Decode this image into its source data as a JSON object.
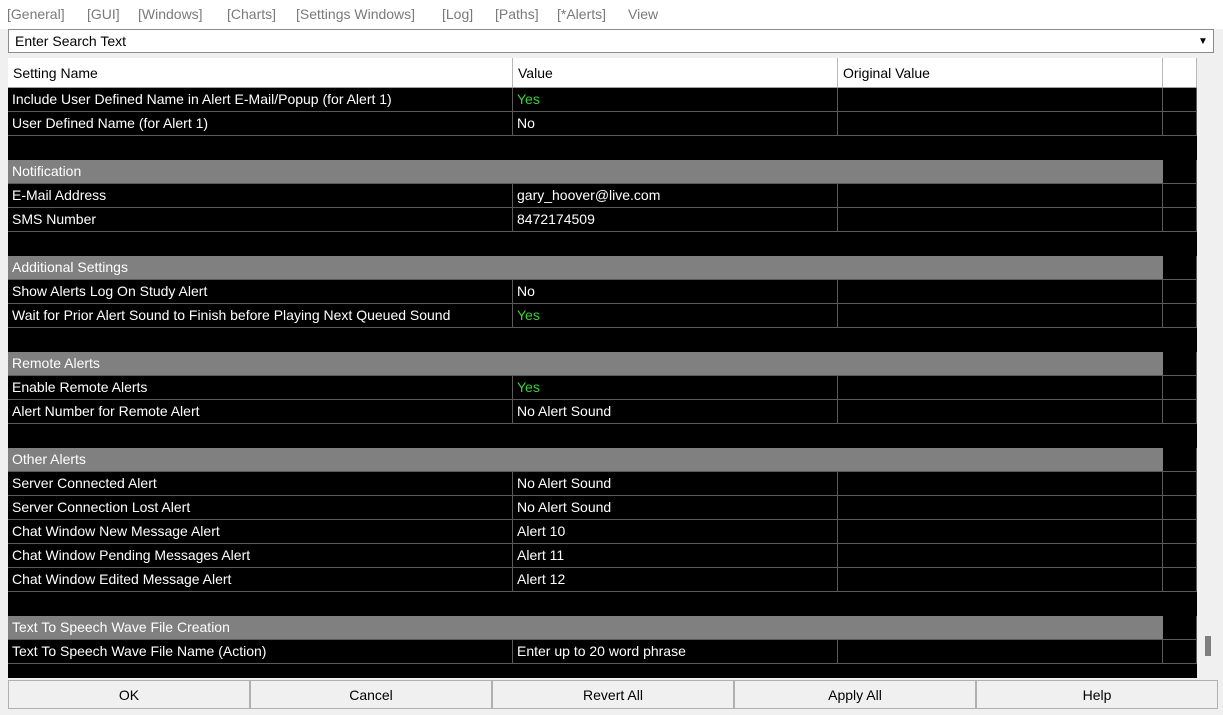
{
  "menu": {
    "tabs": [
      "[General]",
      "[GUI]",
      "[Windows]",
      "[Charts]",
      "[Settings Windows]",
      "[Log]",
      "[Paths]",
      "[*Alerts]",
      "View"
    ]
  },
  "search": {
    "placeholder": "Enter Search Text"
  },
  "grid": {
    "columns": [
      "Setting Name",
      "Value",
      "Original Value"
    ],
    "rows": [
      {
        "type": "item",
        "name": "Include User Defined Name in Alert E-Mail/Popup (for Alert 1)",
        "value": "Yes",
        "original": "",
        "green": true
      },
      {
        "type": "item",
        "name": "User Defined Name (for Alert 1)",
        "value": "No",
        "original": ""
      },
      {
        "type": "blank"
      },
      {
        "type": "section",
        "name": "Notification"
      },
      {
        "type": "item",
        "name": "E-Mail Address",
        "value": "gary_hoover@live.com",
        "original": ""
      },
      {
        "type": "item",
        "name": "SMS Number",
        "value": "8472174509",
        "original": ""
      },
      {
        "type": "blank"
      },
      {
        "type": "section",
        "name": "Additional Settings"
      },
      {
        "type": "item",
        "name": "Show Alerts Log On Study Alert",
        "value": "No",
        "original": ""
      },
      {
        "type": "item",
        "name": "Wait for Prior Alert Sound to Finish before Playing Next Queued Sound",
        "value": "Yes",
        "original": "",
        "green": true
      },
      {
        "type": "blank"
      },
      {
        "type": "section",
        "name": "Remote Alerts"
      },
      {
        "type": "item",
        "name": "Enable Remote Alerts",
        "value": "Yes",
        "original": "",
        "green": true
      },
      {
        "type": "item",
        "name": "Alert Number for Remote Alert",
        "value": "No Alert Sound",
        "original": ""
      },
      {
        "type": "blank"
      },
      {
        "type": "section",
        "name": "Other Alerts"
      },
      {
        "type": "item",
        "name": "Server Connected Alert",
        "value": "No Alert Sound",
        "original": ""
      },
      {
        "type": "item",
        "name": "Server Connection Lost Alert",
        "value": "No Alert Sound",
        "original": ""
      },
      {
        "type": "item",
        "name": "Chat Window New Message Alert",
        "value": "Alert 10",
        "original": ""
      },
      {
        "type": "item",
        "name": "Chat Window Pending Messages Alert",
        "value": "Alert 11",
        "original": ""
      },
      {
        "type": "item",
        "name": "Chat Window Edited Message Alert",
        "value": "Alert 12",
        "original": ""
      },
      {
        "type": "blank"
      },
      {
        "type": "section",
        "name": "Text To Speech Wave File Creation"
      },
      {
        "type": "item",
        "name": "Text To Speech Wave File Name (Action)",
        "value": "Enter up to 20 word phrase",
        "original": ""
      }
    ]
  },
  "buttons": [
    "OK",
    "Cancel",
    "Revert All",
    "Apply All",
    "Help"
  ],
  "colors": {
    "grid_bg": "#000000",
    "section_bg": "#808080",
    "value_yes": "#3ccf3c",
    "text": "#ffffff"
  },
  "icons": {
    "dropdown": "chevron-down-icon"
  }
}
